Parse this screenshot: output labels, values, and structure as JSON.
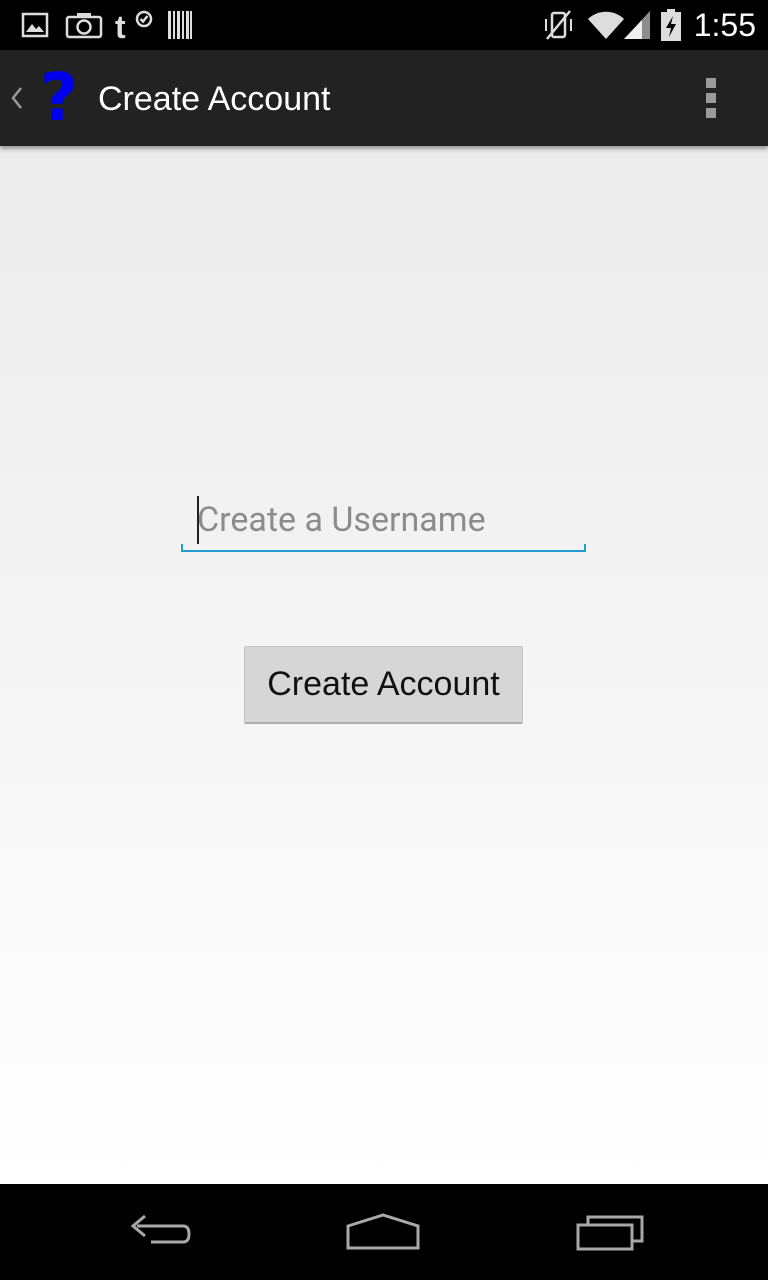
{
  "status_bar": {
    "time": "1:55",
    "left_icons": [
      "gallery-icon",
      "camera-icon",
      "t-check-icon",
      "barcode-icon"
    ],
    "right_icons": [
      "vibrate-off-icon",
      "wifi-icon",
      "signal-icon",
      "battery-charging-icon"
    ]
  },
  "action_bar": {
    "title": "Create Account",
    "app_icon_glyph": "?",
    "app_icon_color": "#0000ee",
    "background": "#222222"
  },
  "form": {
    "username_placeholder": "Create a Username",
    "username_value": "",
    "button_label": "Create Account",
    "accent_color": "#1e9ecf"
  },
  "nav_bar": {
    "buttons": [
      "back-icon",
      "home-icon",
      "recents-icon"
    ]
  }
}
